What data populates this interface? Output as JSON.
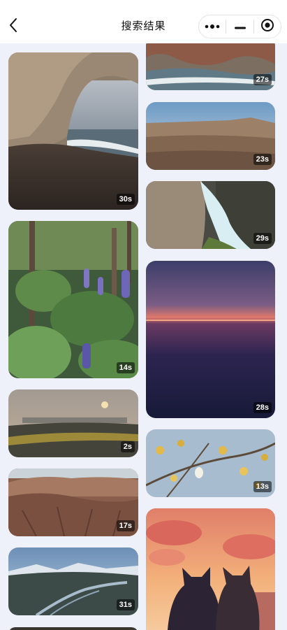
{
  "header": {
    "title": "搜索结果",
    "back_icon": "chevron-left-icon",
    "capsule": {
      "more_icon": "more-dots-icon",
      "minimize_icon": "minimize-icon",
      "close_icon": "target-close-icon"
    }
  },
  "results": {
    "left": [
      {
        "subject": "sea-cave",
        "duration": "30s"
      },
      {
        "subject": "lupine-flowers",
        "duration": "14s"
      },
      {
        "subject": "hazy-city-sunset",
        "duration": "2s"
      },
      {
        "subject": "eroded-hills",
        "duration": "17s"
      },
      {
        "subject": "braided-river-valley",
        "duration": "31s"
      }
    ],
    "right": [
      {
        "subject": "rocky-coast",
        "duration": "27s"
      },
      {
        "subject": "desert-plateau",
        "duration": "23s"
      },
      {
        "subject": "waterfall-rocks",
        "duration": "29s"
      },
      {
        "subject": "ocean-sunset",
        "duration": "28s"
      },
      {
        "subject": "yellow-blossoms",
        "duration": "13s"
      },
      {
        "subject": "cats-at-sunset",
        "duration": ""
      }
    ]
  }
}
